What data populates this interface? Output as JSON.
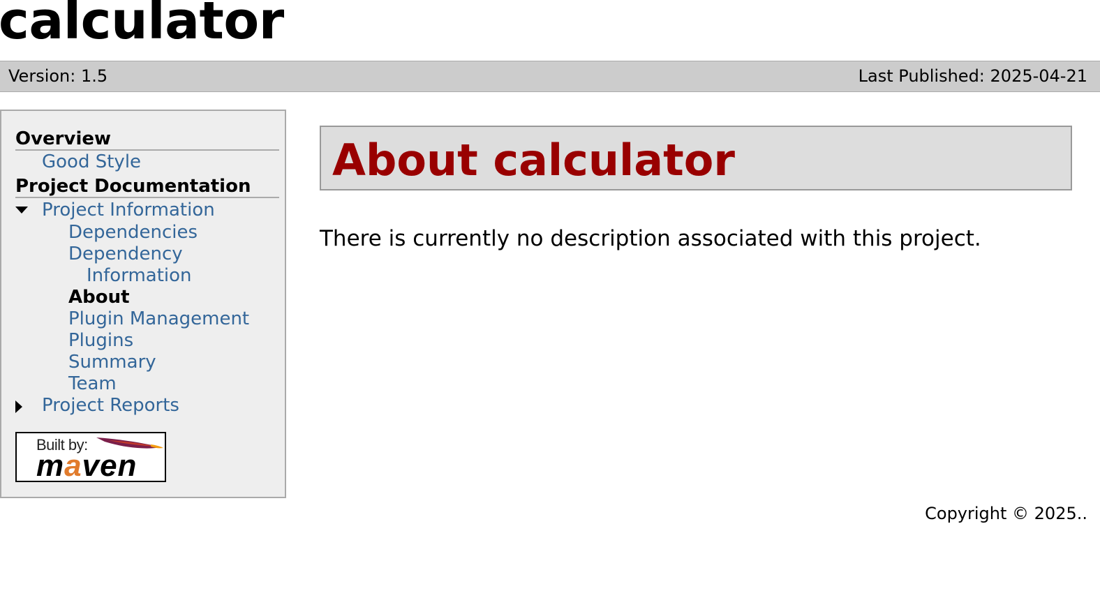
{
  "banner": {
    "title": "calculator"
  },
  "breadcrumbs": {
    "version": "Version: 1.5",
    "last_published": "Last Published: 2025-04-21"
  },
  "nav": {
    "overview_heading": "Overview",
    "good_style": "Good Style",
    "project_docs_heading": "Project Documentation",
    "project_information": "Project Information",
    "dependencies": "Dependencies",
    "dependency_line1": "Dependency",
    "dependency_line2": "Information",
    "about": "About",
    "plugin_management": "Plugin Management",
    "plugins": "Plugins",
    "summary": "Summary",
    "team": "Team",
    "project_reports": "Project Reports"
  },
  "powered_by": {
    "built_by": "Built by:",
    "maven_m": "m",
    "maven_a": "a",
    "maven_rest": "ven",
    "colors": {
      "feather": "#7b1f4a",
      "a_letter": "#e17b2c"
    }
  },
  "main": {
    "section_title": "About calculator",
    "description": "There is currently no description associated with this project."
  },
  "footer": {
    "copyright": "Copyright © 2025.."
  },
  "colors": {
    "link": "#336699",
    "section_title": "#990000",
    "breadcrumbs_bg": "#cccccc",
    "sidebar_bg": "#eeeeee",
    "section_bg": "#dddddd"
  }
}
